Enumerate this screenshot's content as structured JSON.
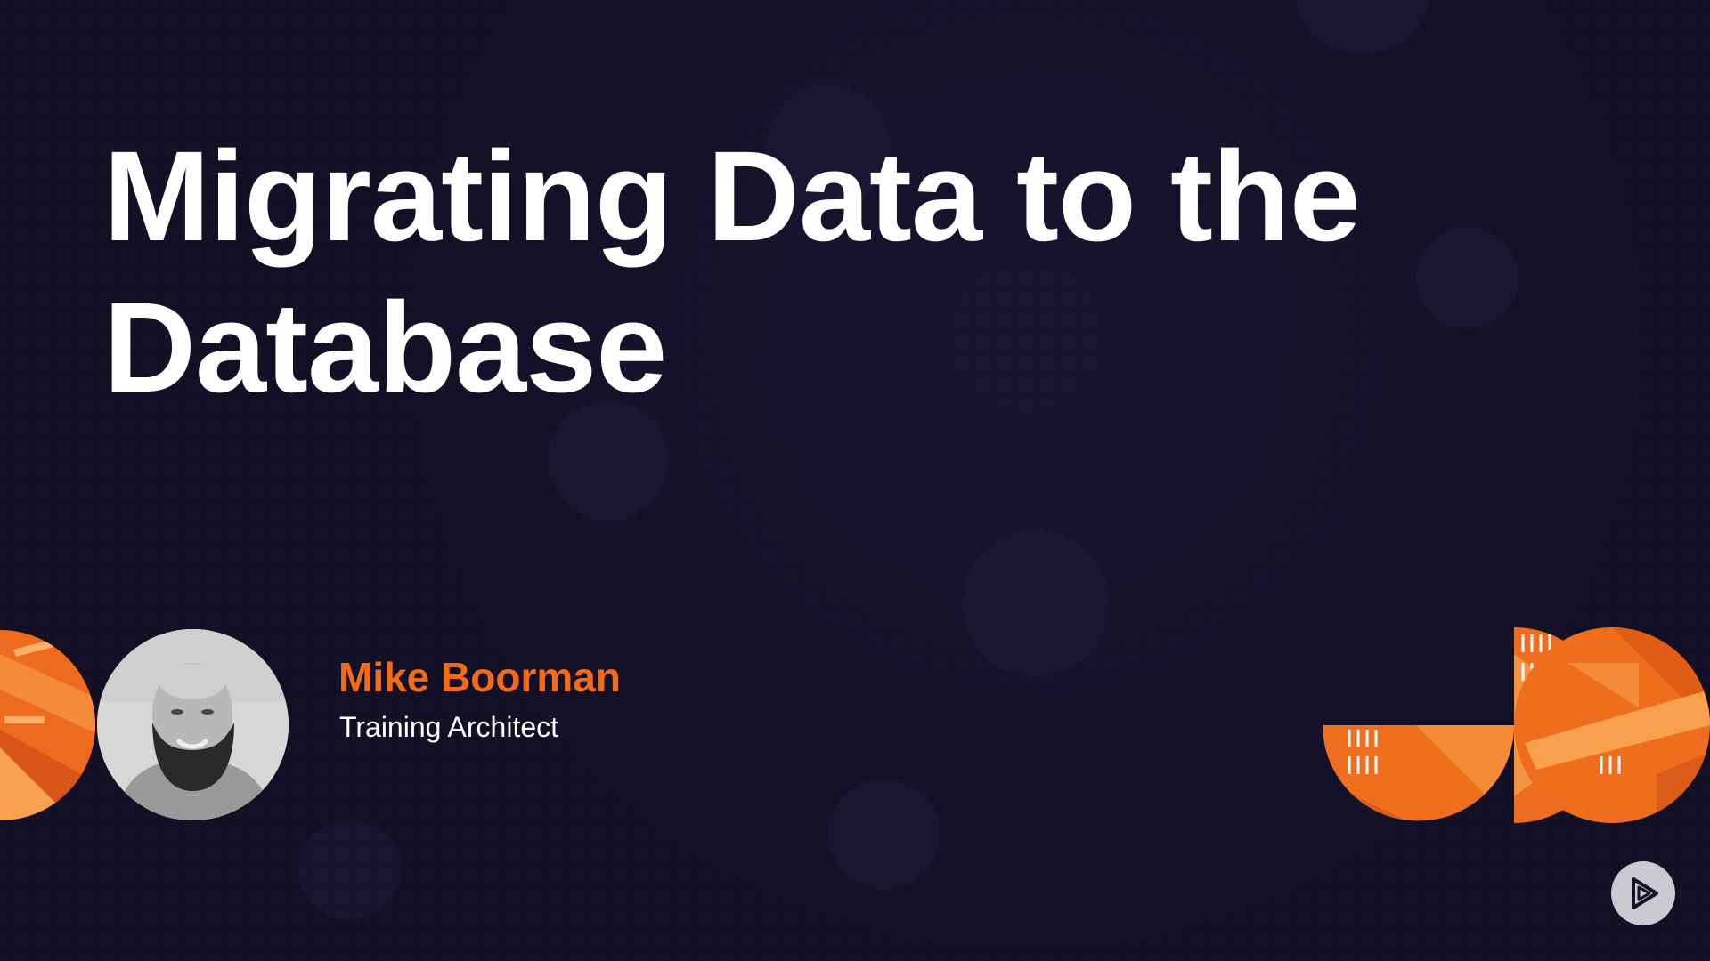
{
  "slide": {
    "title": "Migrating Data to the Database",
    "presenter": {
      "name": "Mike Boorman",
      "role": "Training Architect"
    }
  },
  "colors": {
    "background": "#130f25",
    "accent": "#f26c16",
    "title_text": "#ffffff",
    "play_button": "#c9c9cf"
  },
  "icons": {
    "brand_play": "pluralsight-play-icon",
    "avatar": "presenter-photo"
  }
}
